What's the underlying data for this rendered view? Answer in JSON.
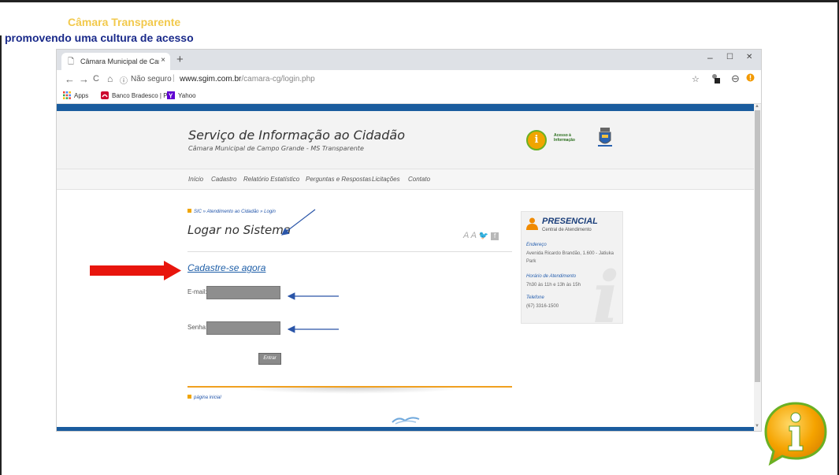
{
  "slide": {
    "title": "Câmara Transparente",
    "subtitle": "promovendo uma cultura de acesso"
  },
  "browser": {
    "tab_title": "Câmara Municipal de Campo Gra",
    "tab_close": "×",
    "new_tab": "+",
    "window_controls": {
      "minimize": "–",
      "maximize": "☐",
      "close": "✕"
    },
    "nav": {
      "back": "←",
      "forward": "→",
      "reload": "C",
      "home": "⌂"
    },
    "security_icon": "ⓘ",
    "security_label": "Não seguro",
    "separator": "|",
    "url_host": "www.sgim.com.br",
    "url_path": "/camara-cg/login.php",
    "bookmarks": [
      {
        "label": "Apps",
        "icon": "apps-grid-icon",
        "color": "#4285f4"
      },
      {
        "label": "Banco Bradesco | Pe:",
        "icon": "bradesco-icon",
        "color": "#cc092f"
      },
      {
        "label": "Yahoo",
        "icon": "yahoo-icon",
        "color": "#6001d2"
      }
    ]
  },
  "site": {
    "header_title": "Serviço de Informação ao Cidadão",
    "header_subtitle": "Câmara Municipal de Campo Grande - MS Transparente",
    "badge_text_line1": "Acesso à",
    "badge_text_line2": "Informação",
    "menu": [
      "Início",
      "Cadastro",
      "Relatório Estatístico",
      "Perguntas e Respostas",
      "Licitações",
      "Contato"
    ],
    "breadcrumb": "SIC » Atendimento ao Cidadão » Login",
    "page_title": "Logar no Sistema",
    "text_tools": "A A",
    "signup_link": "Cadastre-se agora",
    "email_label": "E-mail:",
    "password_label": "Senha:",
    "submit_label": "Entrar",
    "home_link": "página inicial"
  },
  "panel": {
    "title": "PRESENCIAL",
    "subtitle": "Central de Atendimento",
    "address_heading": "Endereço",
    "address": "Avenida Ricardo Brandão, 1.600 - Jatiuka Park",
    "hours_heading": "Horário de Atendimento",
    "hours": "7h30 às 11h e 13h às 15h",
    "phone_heading": "Telefone",
    "phone": "(67) 3316-1500"
  },
  "colors": {
    "accent_blue": "#1a5c9e",
    "slide_title": "#f2c94c",
    "slide_subtitle": "#1a2a8a",
    "annotation_red": "#e8150d",
    "annotation_arrow": "#2a55a8",
    "orange_line": "#f0a020"
  }
}
